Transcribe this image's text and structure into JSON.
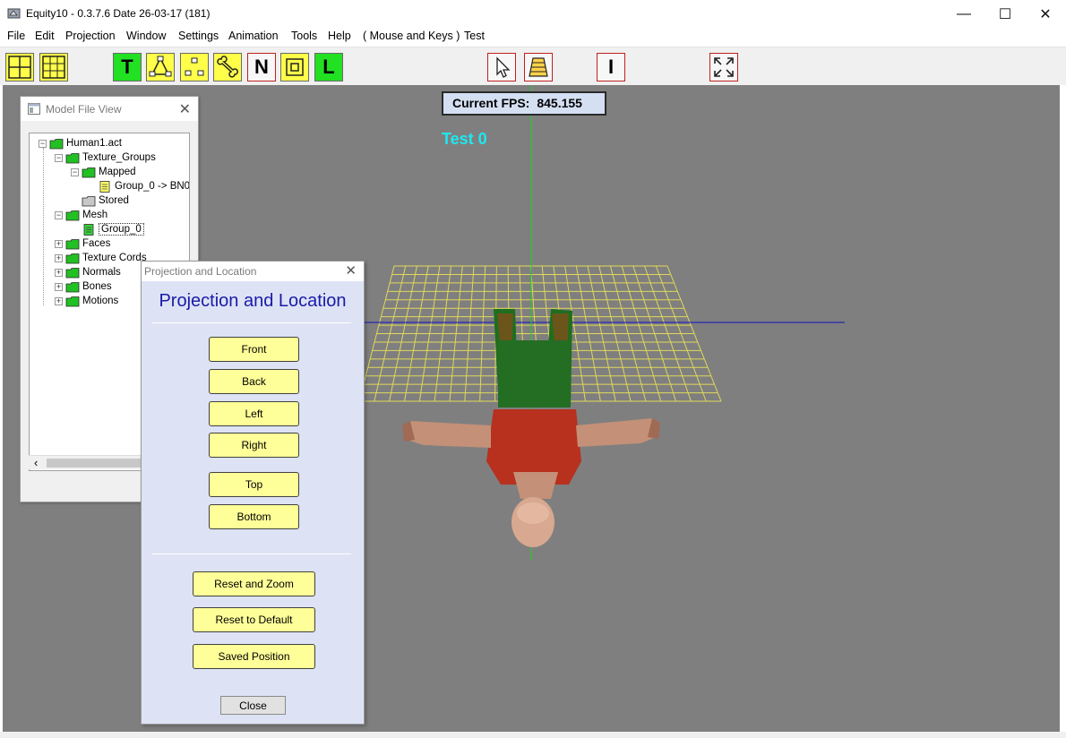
{
  "window": {
    "title": "Equity10 - 0.3.7.6  Date 26-03-17  (181)",
    "minimize": "—",
    "maximize": "☐",
    "close": "✕"
  },
  "menu": [
    "File",
    "Edit",
    "Projection",
    "Window",
    "Settings",
    "Animation",
    "Tools",
    "Help",
    "( Mouse and Keys )",
    "Test"
  ],
  "toolbar": {
    "t_label": "T",
    "n_label": "N",
    "l_label": "L",
    "i_label": "I"
  },
  "viewport": {
    "fps_label": "Current  FPS:",
    "fps_value": "845.155",
    "test_label": "Test  0"
  },
  "model_view": {
    "title": "Model File View",
    "close": "✕",
    "tree": [
      {
        "label": "Human1.act",
        "expander": "−"
      },
      {
        "label": "Texture_Groups",
        "expander": "−"
      },
      {
        "label": "Mapped",
        "expander": "−"
      },
      {
        "label": "Group_0 -> BN0"
      },
      {
        "label": "Stored"
      },
      {
        "label": "Mesh",
        "expander": "−"
      },
      {
        "label": "Group_0"
      },
      {
        "label": "Faces",
        "expander": "+"
      },
      {
        "label": "Texture Cords",
        "expander": "+"
      },
      {
        "label": "Normals",
        "expander": "+"
      },
      {
        "label": "Bones",
        "expander": "+"
      },
      {
        "label": "Motions",
        "expander": "+"
      }
    ],
    "scroll_left": "‹"
  },
  "projection_dialog": {
    "title": "Projection and Location",
    "close": "✕",
    "heading": "Projection and Location",
    "buttons": {
      "front": "Front",
      "back": "Back",
      "left": "Left",
      "right": "Right",
      "top": "Top",
      "bottom": "Bottom",
      "reset_zoom": "Reset and Zoom",
      "reset_default": "Reset to Default",
      "saved_position": "Saved Position",
      "close": "Close"
    }
  },
  "colors": {
    "viewport": "#7f7f7f",
    "grid": "#e0d85a",
    "fps_box": "#d4dff2",
    "test_text": "#1ee8f0",
    "dialog_bg": "#dde3f4",
    "button_yellow": "#ffff99",
    "heading_blue": "#1a1aa8"
  }
}
